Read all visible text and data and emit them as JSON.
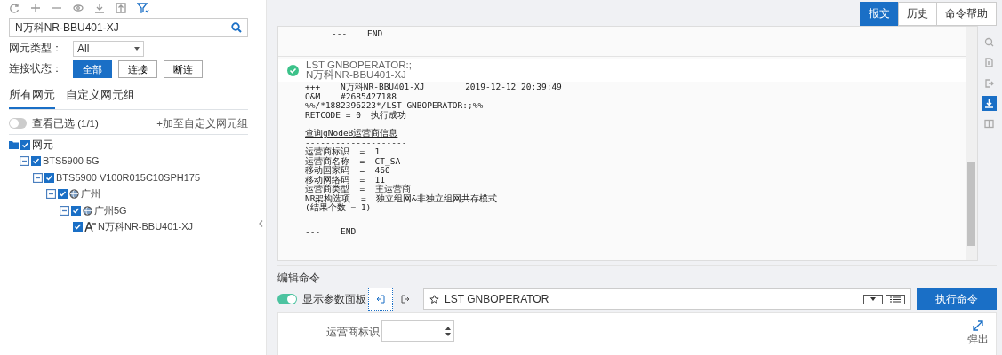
{
  "sidebar": {
    "search": {
      "value": "N万科NR-BBU401-XJ"
    },
    "filters": [
      {
        "label": "网元类型：",
        "kind": "select",
        "value": "All"
      },
      {
        "label": "连接状态：",
        "kind": "buttons",
        "options": [
          {
            "label": "全部",
            "selected": true
          },
          {
            "label": "连接",
            "selected": false
          },
          {
            "label": "断连",
            "selected": false
          }
        ]
      }
    ],
    "tabs": [
      {
        "label": "所有网元",
        "selected": true
      },
      {
        "label": "自定义网元组",
        "selected": false
      }
    ],
    "show_selected": {
      "label": "查看已选 (1/1)",
      "on": false
    },
    "add_link": "+加至自定义网元组",
    "tree": [
      {
        "label": "网元",
        "kind": "folder",
        "checked": true,
        "children": [
          {
            "label": "BTS5900 5G",
            "checked": true,
            "expanded": true,
            "children": [
              {
                "label": "BTS5900 V100R015C10SPH175",
                "checked": true,
                "expanded": true,
                "children": [
                  {
                    "label": "广州",
                    "kind": "region",
                    "checked": true,
                    "expanded": true,
                    "children": [
                      {
                        "label": "广州5G",
                        "kind": "region",
                        "checked": true,
                        "expanded": true,
                        "children": [
                          {
                            "label": "N万科NR-BBU401-XJ",
                            "kind": "ne",
                            "checked": true
                          }
                        ]
                      }
                    ]
                  }
                ]
              }
            ]
          }
        ]
      }
    ]
  },
  "view_tabs": [
    {
      "label": "报文",
      "selected": true
    },
    {
      "label": "历史",
      "selected": false
    },
    {
      "label": "命令帮助",
      "selected": false
    }
  ],
  "output": {
    "blocks": [
      {
        "kind": "end",
        "paragraphs": [
          [
            "---    END"
          ]
        ]
      },
      {
        "kind": "command",
        "success": true,
        "command": "LST GNBOPERATOR:;",
        "ne": "N万科NR-BBU401-XJ",
        "paragraphs": [
          [
            "+++    N万科NR-BBU401-XJ        2019-12-12 20:39:49",
            "O&M    #2685427188",
            "%%/*1882396223*/LST GNBOPERATOR:;%%",
            "RETCODE = 0  执行成功"
          ],
          [
            "查询gNodeB运营商信息",
            "--------------------",
            "运营商标识  =  1",
            "运营商名称  =  CT_SA",
            "移动国家码  =  460",
            "移动网络码  =  11",
            "运营商类型  =  主运营商",
            "NR架构选项  =  独立组网&非独立组网共存模式",
            "(结果个数 = 1)"
          ],
          [
            "---    END"
          ]
        ]
      }
    ]
  },
  "side_tools": [
    {
      "kind": "search",
      "selected": false
    },
    {
      "kind": "doc",
      "selected": false
    },
    {
      "kind": "export",
      "selected": false
    },
    {
      "kind": "download",
      "selected": true
    },
    {
      "kind": "columns",
      "selected": false
    }
  ],
  "editor": {
    "title": "编辑命令",
    "panel_toggle": {
      "label": "显示参数面板",
      "on": true
    },
    "command": {
      "value": "LST GNBOPERATOR"
    },
    "run_button": "执行命令",
    "params": [
      {
        "label": "运营商标识"
      }
    ],
    "popout": "弹出"
  }
}
